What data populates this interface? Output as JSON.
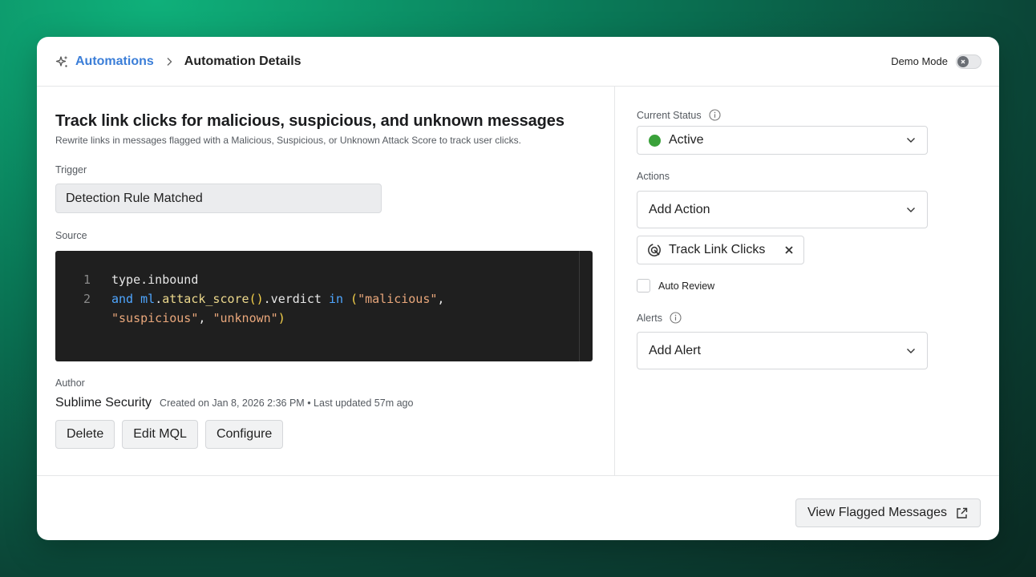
{
  "breadcrumb": {
    "parent": "Automations",
    "current": "Automation Details"
  },
  "header": {
    "demo_mode_label": "Demo Mode",
    "demo_mode_on": false
  },
  "automation": {
    "title": "Track link clicks for malicious, suspicious, and unknown messages",
    "description": "Rewrite links in messages flagged with a Malicious, Suspicious, or Unknown Attack Score to track user clicks.",
    "trigger_label": "Trigger",
    "trigger_value": "Detection Rule Matched",
    "source_label": "Source",
    "source_lines": [
      {
        "num": "1",
        "text": "type.inbound"
      },
      {
        "num": "2",
        "text": "and ml.attack_score().verdict in (\"malicious\","
      },
      {
        "num": "",
        "text": "\"suspicious\", \"unknown\")"
      }
    ],
    "author_label": "Author",
    "author_name": "Sublime Security",
    "meta": "Created on Jan 8, 2026 2:36 PM • Last updated 57m ago",
    "buttons": {
      "delete": "Delete",
      "edit": "Edit MQL",
      "configure": "Configure"
    }
  },
  "sidebar": {
    "status_label": "Current Status",
    "status_value": "Active",
    "status_color": "#3aa13a",
    "actions_label": "Actions",
    "add_action": "Add Action",
    "action_chip": "Track Link Clicks",
    "auto_review": "Auto Review",
    "alerts_label": "Alerts",
    "add_alert": "Add Alert"
  },
  "footer": {
    "view_flagged": "View Flagged Messages"
  },
  "colors": {
    "link": "#3b7ed8",
    "code_bg": "#1f1f1f",
    "keyword": "#4fa6ff",
    "string": "#e9a77b"
  }
}
